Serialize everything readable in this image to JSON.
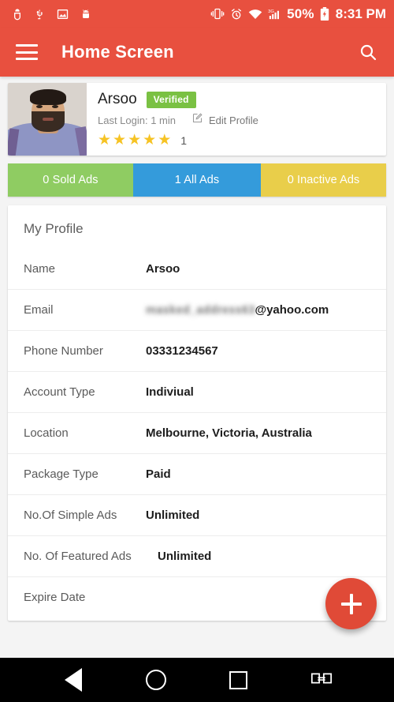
{
  "statusbar": {
    "left_icons": [
      "bug-icon",
      "usb-icon",
      "screenshot-image-icon",
      "android-debug-icon"
    ],
    "right_icons": [
      "vibrate-icon",
      "alarm-icon",
      "wifi-icon",
      "cellular-3g-signal-icon",
      "battery-charging-icon"
    ],
    "battery_percent": "50%",
    "time": "8:31 PM"
  },
  "appbar": {
    "menu_icon": "hamburger-menu-icon",
    "title": "Home Screen",
    "search_icon": "search-icon",
    "color": "#e8503f"
  },
  "profile": {
    "avatar_alt": "user-profile-photo",
    "name": "Arsoo",
    "verified_badge": "Verified",
    "verified_color": "#7ac143",
    "last_login": "Last Login: 1 min",
    "edit_icon": "edit-pencil-icon",
    "edit_label": "Edit Profile",
    "stars": 5,
    "star_glyph": "★",
    "star_color": "#f6c324",
    "rating_count": "1"
  },
  "tabs": [
    {
      "label": "0 Sold Ads",
      "color": "#8fcc62",
      "name": "tab-sold-ads",
      "selected": false
    },
    {
      "label": "1 All Ads",
      "color": "#349bdb",
      "name": "tab-all-ads",
      "selected": true
    },
    {
      "label": "0 Inactive Ads",
      "color": "#e9ce4a",
      "name": "tab-inactive-ads",
      "selected": false
    }
  ],
  "details": {
    "title": "My Profile",
    "rows": [
      {
        "label": "Name",
        "value": "Arsoo",
        "masked": ""
      },
      {
        "label": "Email",
        "value": "@yahoo.com",
        "masked": "masked_address63"
      },
      {
        "label": "Phone Number",
        "value": "03331234567",
        "masked": ""
      },
      {
        "label": "Account Type",
        "value": "Indiviual",
        "masked": ""
      },
      {
        "label": "Location",
        "value": "Melbourne, Victoria, Australia",
        "masked": ""
      },
      {
        "label": "Package Type",
        "value": "Paid",
        "masked": ""
      },
      {
        "label": "No.Of Simple Ads",
        "value": "Unlimited",
        "masked": ""
      },
      {
        "label": "No. Of Featured Ads",
        "value": "Unlimited",
        "masked": ""
      },
      {
        "label": "Expire Date",
        "value": "",
        "masked": ""
      }
    ]
  },
  "fab": {
    "icon": "plus-icon",
    "color": "#e04a37"
  },
  "navbar": {
    "back": "back-triangle-icon",
    "home": "home-circle-icon",
    "recents": "recents-square-icon",
    "rotate": "screen-rotate-icon"
  }
}
